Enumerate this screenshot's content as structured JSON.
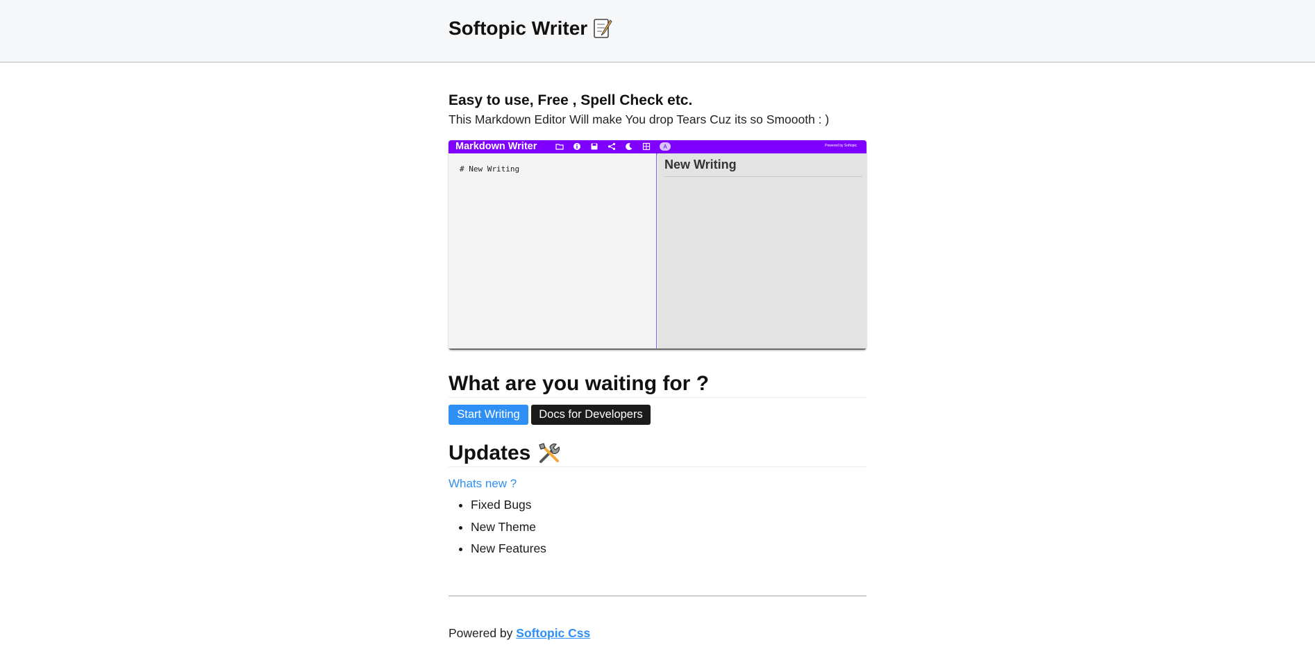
{
  "header": {
    "title": "Softopic Writer",
    "icon": "memo-icon"
  },
  "intro": {
    "tagline": "Easy to use, Free , Spell Check etc.",
    "description": "This Markdown Editor Will make You drop Tears Cuz its so Smoooth : )"
  },
  "preview": {
    "brand": "Markdown Writer",
    "powered": "Powered by Softopic",
    "toolbar_icons": [
      "folder-icon",
      "info-icon",
      "save-icon",
      "share-icon",
      "moon-icon",
      "grid-icon",
      "spellcheck-icon"
    ],
    "editor_text": "# New Writing",
    "rendered_heading": "New Writing",
    "accent_color": "#8000ff"
  },
  "cta": {
    "heading": "What are you waiting for ?",
    "start_label": "Start Writing",
    "docs_label": "Docs for Developers"
  },
  "updates": {
    "heading": "Updates",
    "icon": "tools-icon",
    "link": "Whats new ?",
    "items": [
      "Fixed Bugs",
      "New Theme",
      "New Features"
    ]
  },
  "footer": {
    "prefix": "Powered by",
    "link": "Softopic Css"
  },
  "colors": {
    "link": "#2e8ff5",
    "dark_button": "#1b1b1b",
    "header_bg": "#f6f7f9"
  }
}
